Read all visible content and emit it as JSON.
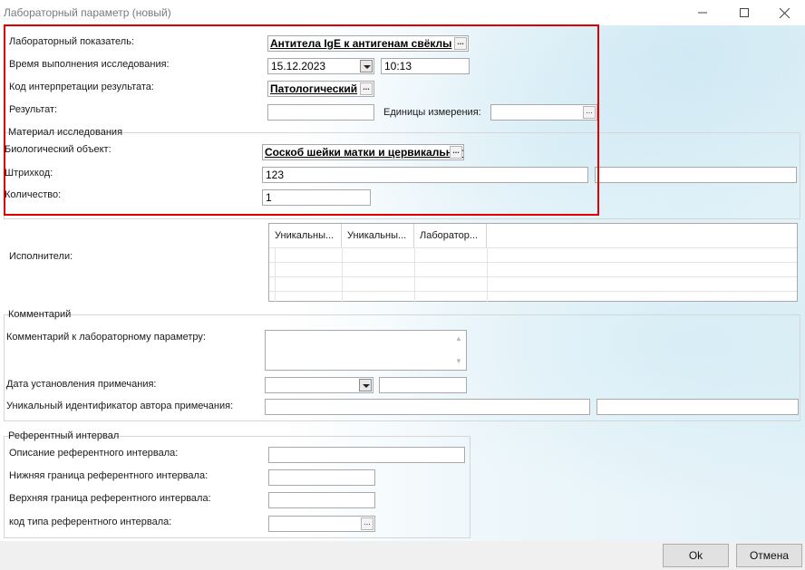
{
  "window": {
    "title": "Лабораторный параметр (новый)",
    "minimize_icon": "minimize-icon",
    "maximize_icon": "maximize-icon",
    "close_icon": "close-icon"
  },
  "main": {
    "lab_indicator_label": "Лабораторный показатель:",
    "lab_indicator_value": "Антитела IgE к антигенам свёклы",
    "exec_time_label": "Время выполнения исследования:",
    "exec_date": "15.12.2023",
    "exec_time": "10:13",
    "interp_code_label": "Код интерпретации результата:",
    "interp_code_value": "Патологический",
    "result_label": "Результат:",
    "result_value": "",
    "units_label": "Единицы измерения:",
    "units_value": ""
  },
  "material": {
    "group_label": "Материал исследования",
    "bio_object_label": "Биологический объект:",
    "bio_object_value": "Соскоб шейки матки и цервикального канала",
    "barcode_label": "Штрихкод:",
    "barcode_value": "123",
    "barcode_extra": "",
    "quantity_label": "Количество:",
    "quantity_value": "1"
  },
  "performers": {
    "label": "Исполнители:",
    "columns": [
      "Уникальны...",
      "Уникальны...",
      "Лаборатор..."
    ]
  },
  "comment": {
    "group_label": "Комментарий",
    "comment_label": "Комментарий к лабораторному параметру:",
    "comment_value": "",
    "note_date_label": "Дата установления примечания:",
    "note_date": "",
    "note_time": "",
    "author_id_label": "Уникальный идентификатор автора примечания:",
    "author_id_value": "",
    "author_id_extra": ""
  },
  "reference": {
    "group_label": "Референтный интервал",
    "desc_label": "Описание референтного интервала:",
    "desc_value": "",
    "lower_label": "Нижняя граница референтного интервала:",
    "lower_value": "",
    "upper_label": "Верхняя граница референтного интервала:",
    "upper_value": "",
    "type_label": "код типа референтного интервала:",
    "type_value": ""
  },
  "buttons": {
    "ok": "Ok",
    "cancel": "Отмена"
  },
  "misc": {
    "ellipsis": "...",
    "highlight_color": "#e00000"
  }
}
